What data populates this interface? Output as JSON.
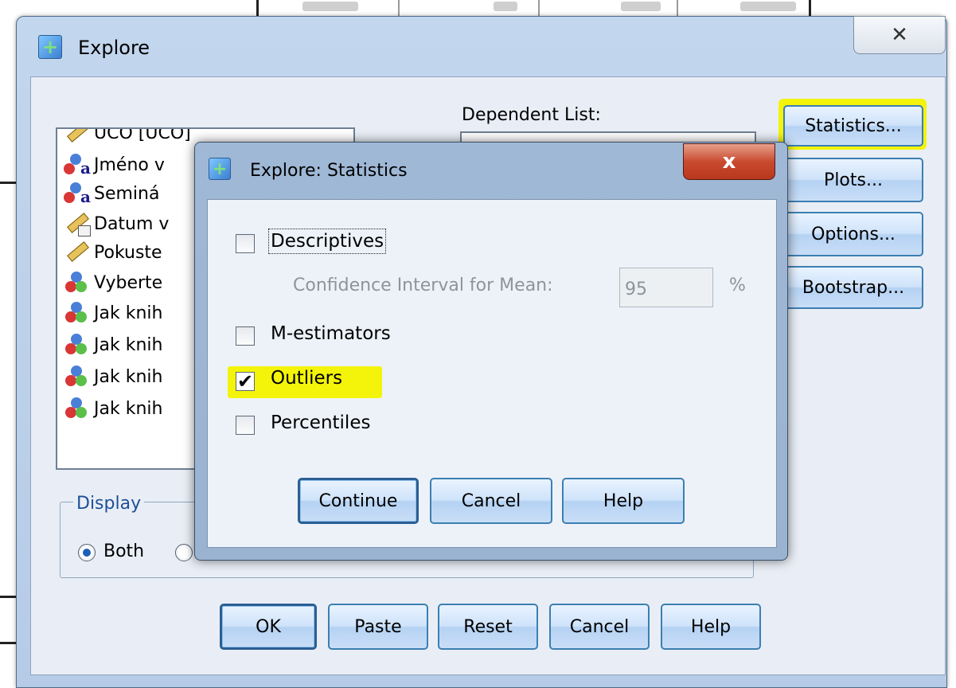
{
  "explore_window": {
    "title": "Explore",
    "dependent_list_label": "Dependent List:",
    "variables": [
      {
        "label": "UČO [UČO]",
        "icon": "scale-ruler-icon"
      },
      {
        "label": "Jméno v",
        "icon": "nominal-string-icon"
      },
      {
        "label": "Seminá",
        "icon": "nominal-string-icon"
      },
      {
        "label": "Datum v",
        "icon": "date-scale-icon"
      },
      {
        "label": "Pokuste",
        "icon": "scale-ruler-icon"
      },
      {
        "label": "Vyberte",
        "icon": "nominal-icon"
      },
      {
        "label": "Jak knih",
        "icon": "nominal-icon"
      },
      {
        "label": "Jak knih",
        "icon": "nominal-icon"
      },
      {
        "label": "Jak knih",
        "icon": "nominal-icon"
      },
      {
        "label": "Jak knih",
        "icon": "nominal-icon"
      }
    ],
    "side_buttons": {
      "statistics": "Statistics...",
      "plots": "Plots...",
      "options": "Options...",
      "bootstrap": "Bootstrap..."
    },
    "display_group": {
      "label": "Display",
      "options": [
        {
          "label": "Both",
          "selected": true
        }
      ]
    },
    "bottom_buttons": {
      "ok": "OK",
      "paste": "Paste",
      "reset": "Reset",
      "cancel": "Cancel",
      "help": "Help"
    }
  },
  "stats_dialog": {
    "title": "Explore: Statistics",
    "options": {
      "descriptives": {
        "label": "Descriptives",
        "checked": false
      },
      "ci_label": "Confidence Interval for Mean:",
      "ci_value": "95",
      "ci_unit": "%",
      "m_estimators": {
        "label": "M-estimators",
        "checked": false
      },
      "outliers": {
        "label": "Outliers",
        "checked": true
      },
      "percentiles": {
        "label": "Percentiles",
        "checked": false
      }
    },
    "buttons": {
      "continue": "Continue",
      "cancel": "Cancel",
      "help": "Help"
    },
    "close_glyph": "x"
  },
  "colors": {
    "highlight": "#f4f40a",
    "button_border": "#3c7fb1",
    "close_red": "#c84a2f"
  }
}
